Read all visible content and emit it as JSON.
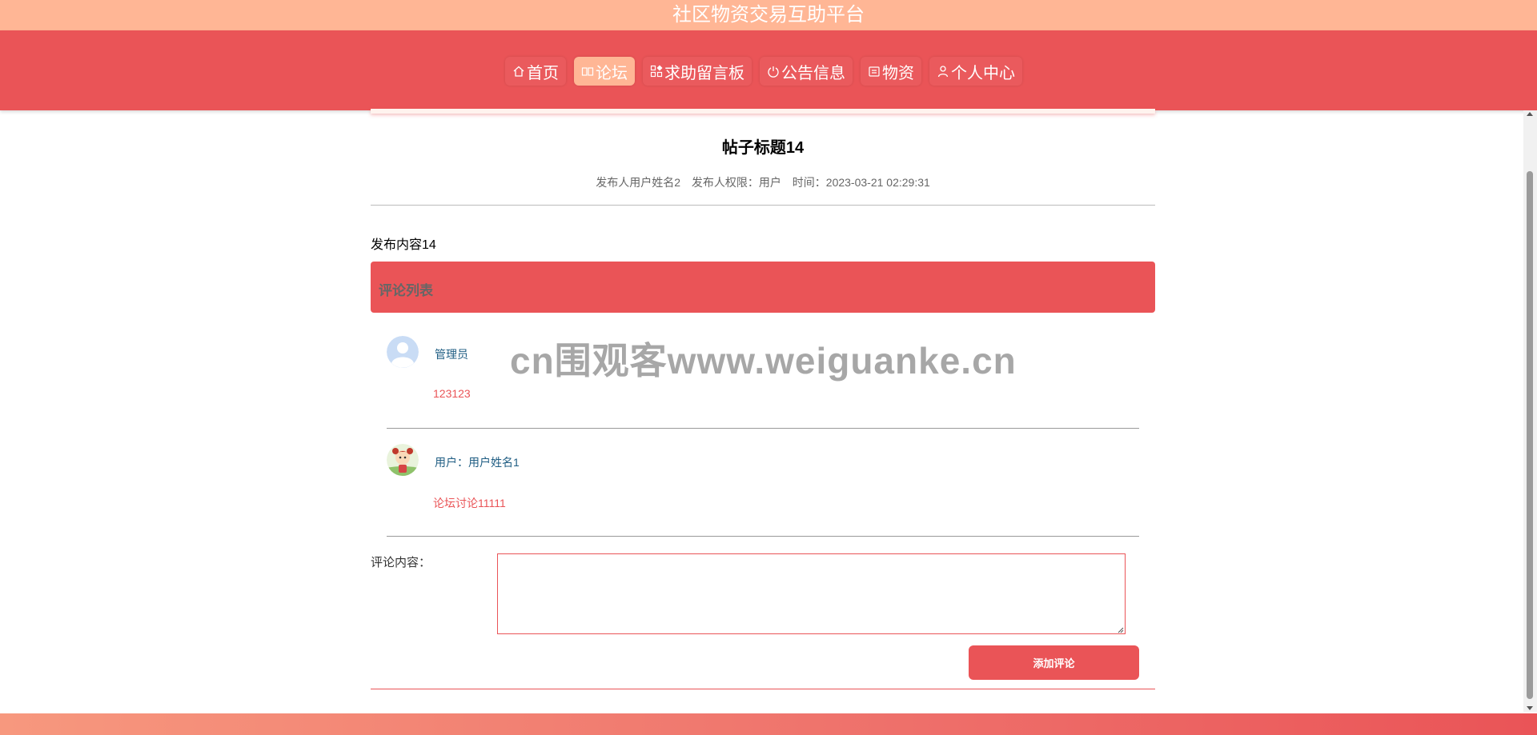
{
  "site": {
    "title": "社区物资交易互助平台"
  },
  "nav": {
    "items": [
      {
        "label": "首页",
        "icon": "home-icon",
        "active": false
      },
      {
        "label": "论坛",
        "icon": "forum-icon",
        "active": true
      },
      {
        "label": "求助留言板",
        "icon": "grid-icon",
        "active": false
      },
      {
        "label": "公告信息",
        "icon": "power-icon",
        "active": false
      },
      {
        "label": "物资",
        "icon": "box-icon",
        "active": false
      },
      {
        "label": "个人中心",
        "icon": "user-icon",
        "active": false
      }
    ]
  },
  "post": {
    "title": "帖子标题14",
    "author": "发布人用户姓名2",
    "role": "发布人权限：用户",
    "time": "时间：2023-03-21 02:29:31",
    "content": "发布内容14"
  },
  "comments": {
    "header": "评论列表",
    "items": [
      {
        "user": "管理员",
        "text": "123123",
        "avatar": "default-avatar-icon"
      },
      {
        "user": "用户：用户姓名1",
        "text": "论坛讨论11111",
        "avatar": "cartoon-avatar-icon"
      }
    ]
  },
  "form": {
    "label": "评论内容：",
    "placeholder": "",
    "value": "",
    "submit_label": "添加评论"
  },
  "watermark": "cn围观客www.weiguanke.cn",
  "colors": {
    "primary": "#EA5457",
    "accent": "#FFB695",
    "link": "#1f5d83"
  }
}
